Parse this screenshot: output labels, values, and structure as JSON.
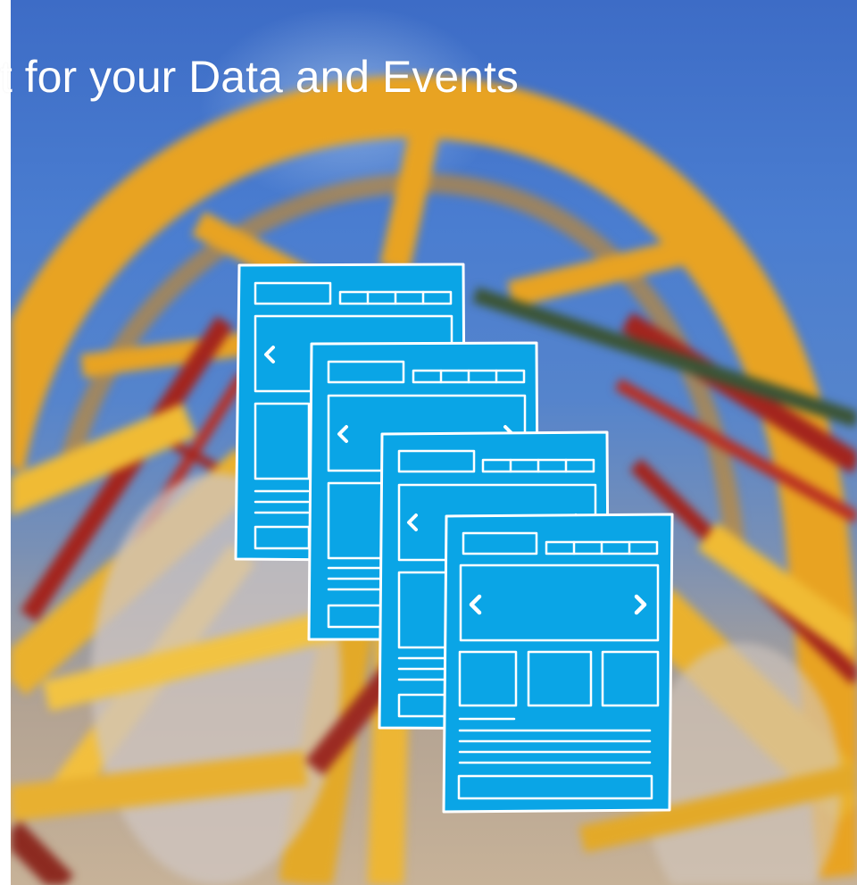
{
  "hero": {
    "headline": "t for your Data and Events",
    "background_image": "blurred upward view of a yellow and red industrial tower structure against blue sky"
  },
  "illustration": {
    "icon": "stacked-wireframe-pages-icon",
    "page_count": 4,
    "page_color": "#0aa5e6",
    "stroke_color": "#ffffff"
  }
}
